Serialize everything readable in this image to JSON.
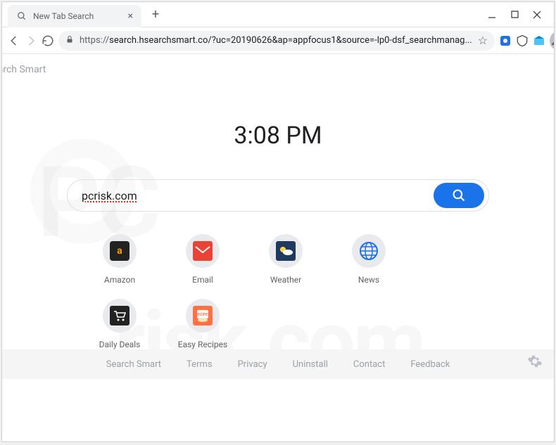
{
  "tab": {
    "title": "New Tab Search"
  },
  "url": {
    "protocol": "https://",
    "rest": "search.hsearchsmart.co/?uc=20190626&ap=appfocus1&source=-lp0-dsf_searchmanag..."
  },
  "brand": "Search Smart",
  "clock": "3:08 PM",
  "search": {
    "value": "pcrisk.com"
  },
  "shortcuts": [
    {
      "label": "Amazon",
      "icon": "amazon"
    },
    {
      "label": "Email",
      "icon": "email"
    },
    {
      "label": "Weather",
      "icon": "weather"
    },
    {
      "label": "News",
      "icon": "news"
    },
    {
      "label": "Daily Deals",
      "icon": "deals"
    },
    {
      "label": "Easy Recipes",
      "icon": "recipes"
    }
  ],
  "footer": [
    "Search Smart",
    "Terms",
    "Privacy",
    "Uninstall",
    "Contact",
    "Feedback"
  ]
}
